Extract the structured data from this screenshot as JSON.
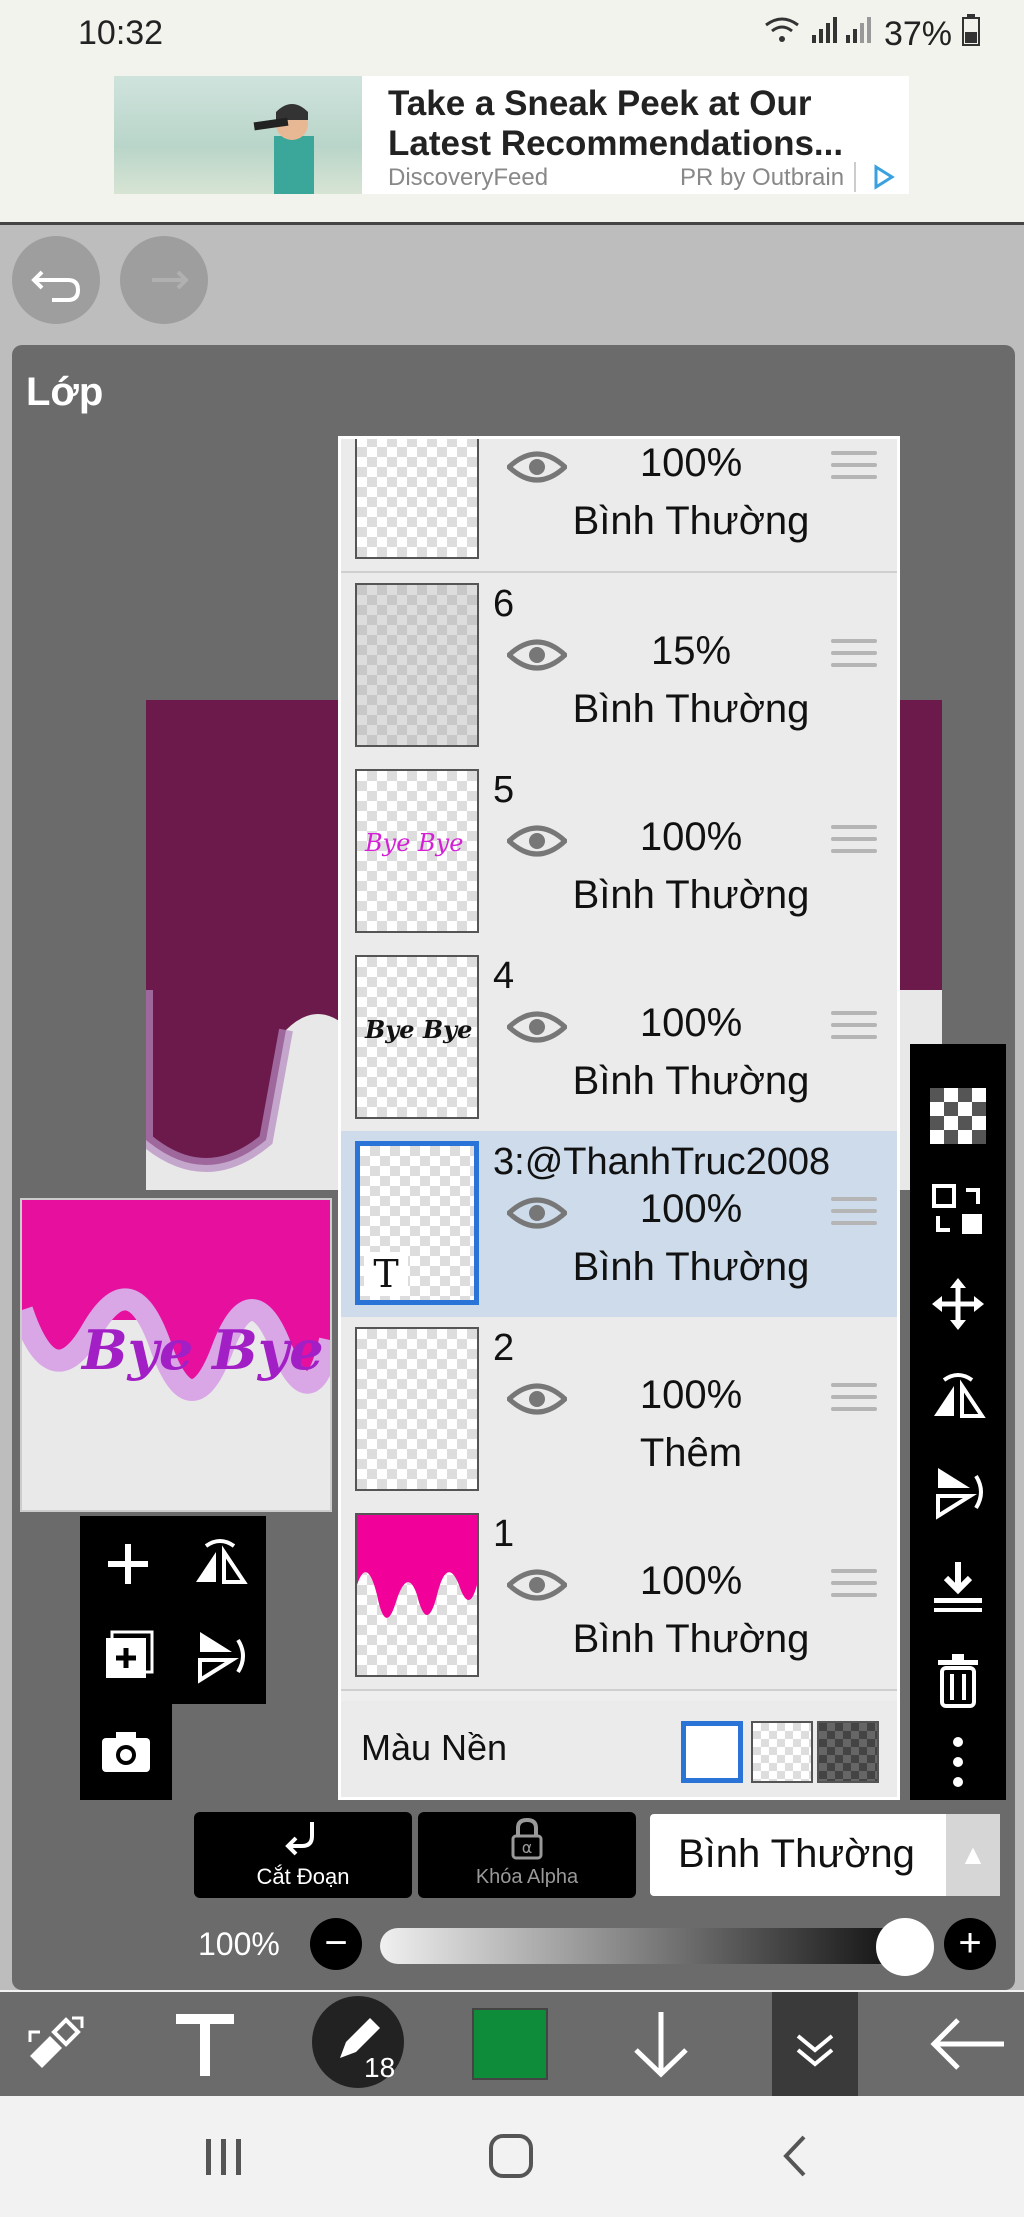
{
  "status_bar": {
    "time": "10:32",
    "battery": "37%"
  },
  "ad": {
    "title": "Take a Sneak Peek at Our Latest Recommendations...",
    "source": "DiscoveryFeed",
    "pr": "PR by Outbrain"
  },
  "panel": {
    "title": "Lớp"
  },
  "layers": [
    {
      "num": "",
      "opacity": "100%",
      "blend": "Bình Thường"
    },
    {
      "num": "6",
      "opacity": "15%",
      "blend": "Bình Thường"
    },
    {
      "num": "5",
      "opacity": "100%",
      "blend": "Bình Thường",
      "thumb_text": "Bye Bye"
    },
    {
      "num": "4",
      "opacity": "100%",
      "blend": "Bình Thường",
      "thumb_text": "Bye Bye"
    },
    {
      "num": "3:@ThanhTruc2008",
      "opacity": "100%",
      "blend": "Bình Thường"
    },
    {
      "num": "2",
      "opacity": "100%",
      "blend": "Thêm"
    },
    {
      "num": "1",
      "opacity": "100%",
      "blend": "Bình Thường"
    }
  ],
  "background_row": {
    "label": "Màu Nền"
  },
  "preview_text": "Bye Bye",
  "text_layer_marker": "T",
  "controls": {
    "clip_label": "Cắt Đoạn",
    "alpha_lock_label": "Khóa Alpha",
    "blend_mode": "Bình Thường",
    "opacity_label": "100%",
    "opacity_value": 1.0
  },
  "bottom_toolbar": {
    "brush_size": "18",
    "color": "#0e8c3a"
  },
  "colors": {
    "selection": "#2a74d8",
    "magenta": "#e60f9e"
  }
}
